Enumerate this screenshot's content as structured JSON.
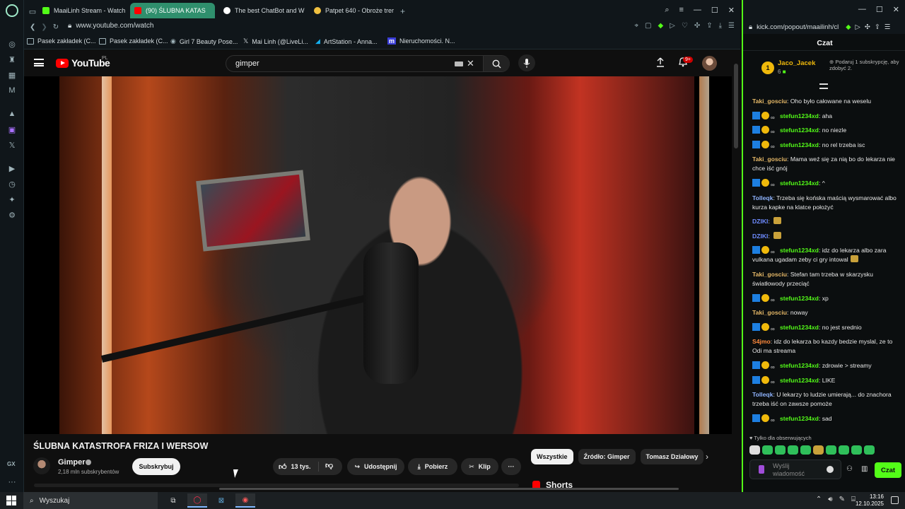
{
  "browser": {
    "tabs": [
      {
        "label": "MaaiLinh Stream - Watch",
        "fav_color": "#53fc18"
      },
      {
        "label": "(90) ŚLUBNA KATAS",
        "fav_color": "#ff0000"
      },
      {
        "label": "The best ChatBot and W",
        "fav_color": "#ffffff"
      },
      {
        "label": "Patpet 640 - Obroże trer",
        "fav_color": "#f0c040"
      }
    ],
    "url": "www.youtube.com/watch",
    "bookmarks": [
      "Pasek zakładek (C...",
      "Pasek zakładek (C...",
      "Girl 7 Beauty Pose...",
      "Mai Linh (@LiveLi...",
      "ArtStation - Anna...",
      "Nieruchomości. N..."
    ]
  },
  "youtube": {
    "logo_text": "YouTube",
    "region": "PL",
    "search_value": "gimper",
    "notif_count": "9+",
    "video_title": "ŚLUBNA KATASTROFA FRIZA I WERSOW",
    "channel_name": "Gimper",
    "channel_subs": "2,18 mln subskrybentów",
    "subscribe_label": "Subskrybuj",
    "like_count": "13 tys.",
    "share_label": "Udostępnij",
    "download_label": "Pobierz",
    "clip_label": "Klip",
    "more_label": "···",
    "chips": [
      "Wszystkie",
      "Źródło: Gimper",
      "Tomasz Działowy"
    ],
    "shorts_label": "Shorts"
  },
  "kick": {
    "url": "kick.com/popout/maailinh/cl",
    "header": "Czat",
    "gift": {
      "badge": "1",
      "user": "Jaco_Jacek",
      "count": "6",
      "cta": "Podaruj 1 subskrypcję, aby zdobyć 2."
    },
    "messages": [
      {
        "user": "Taki_gosciu",
        "color": "#e5b867",
        "badges": 0,
        "text": "Oho było całowane na weselu"
      },
      {
        "user": "stefun1234xd",
        "color": "#53fc18",
        "badges": 3,
        "text": "aha"
      },
      {
        "user": "stefun1234xd",
        "color": "#53fc18",
        "badges": 3,
        "text": "no niezle"
      },
      {
        "user": "stefun1234xd",
        "color": "#53fc18",
        "badges": 3,
        "text": "no rel trzeba isc"
      },
      {
        "user": "Taki_gosciu",
        "color": "#e5b867",
        "badges": 0,
        "text": "Mama weź się za nią bo do lekarza nie chce iść gnój"
      },
      {
        "user": "stefun1234xd",
        "color": "#53fc18",
        "badges": 3,
        "text": "^"
      },
      {
        "user": "Tolleqk",
        "color": "#8fb4ff",
        "badges": 0,
        "text": "Trzeba się końska maścią wysmarować albo kurza kapke na klatce położyć"
      },
      {
        "user": "DZIKI",
        "color": "#6f8cff",
        "badges": 0,
        "text": "",
        "emote": true
      },
      {
        "user": "DZIKI",
        "color": "#6f8cff",
        "badges": 0,
        "text": "",
        "emote": true
      },
      {
        "user": "stefun1234xd",
        "color": "#53fc18",
        "badges": 3,
        "text": "idz do lekarza albo zara vulkana ugadam zeby ci gry intowal",
        "emote": true
      },
      {
        "user": "Taki_gosciu",
        "color": "#e5b867",
        "badges": 0,
        "text": "Stefan tam trzeba w skarzysku światłowody przeciąć"
      },
      {
        "user": "stefun1234xd",
        "color": "#53fc18",
        "badges": 3,
        "text": "xp"
      },
      {
        "user": "Taki_gosciu",
        "color": "#e5b867",
        "badges": 0,
        "text": "noway"
      },
      {
        "user": "stefun1234xd",
        "color": "#53fc18",
        "badges": 3,
        "text": "no jest srednio"
      },
      {
        "user": "S4jmo",
        "color": "#ff8a3d",
        "badges": 0,
        "text": "idz do lekarza bo kazdy bedzie myslal, ze to Odi ma streama"
      },
      {
        "user": "stefun1234xd",
        "color": "#53fc18",
        "badges": 3,
        "text": "zdrowie > streamy"
      },
      {
        "user": "stefun1234xd",
        "color": "#53fc18",
        "badges": 3,
        "text": "LIKE"
      },
      {
        "user": "Tolleqk",
        "color": "#8fb4ff",
        "badges": 0,
        "text": "U lekarzy to ludzie umierają... do znachora trzeba iść on zawsze pomoże"
      },
      {
        "user": "stefun1234xd",
        "color": "#53fc18",
        "badges": 3,
        "text": "sad"
      }
    ],
    "follow_only": "Tylko dla obserwujących",
    "input_placeholder": "Wyślij wiadomość",
    "send_label": "Czat"
  },
  "taskbar": {
    "search_placeholder": "Wyszukaj",
    "time": "13:16",
    "date": "12.10.2025"
  }
}
